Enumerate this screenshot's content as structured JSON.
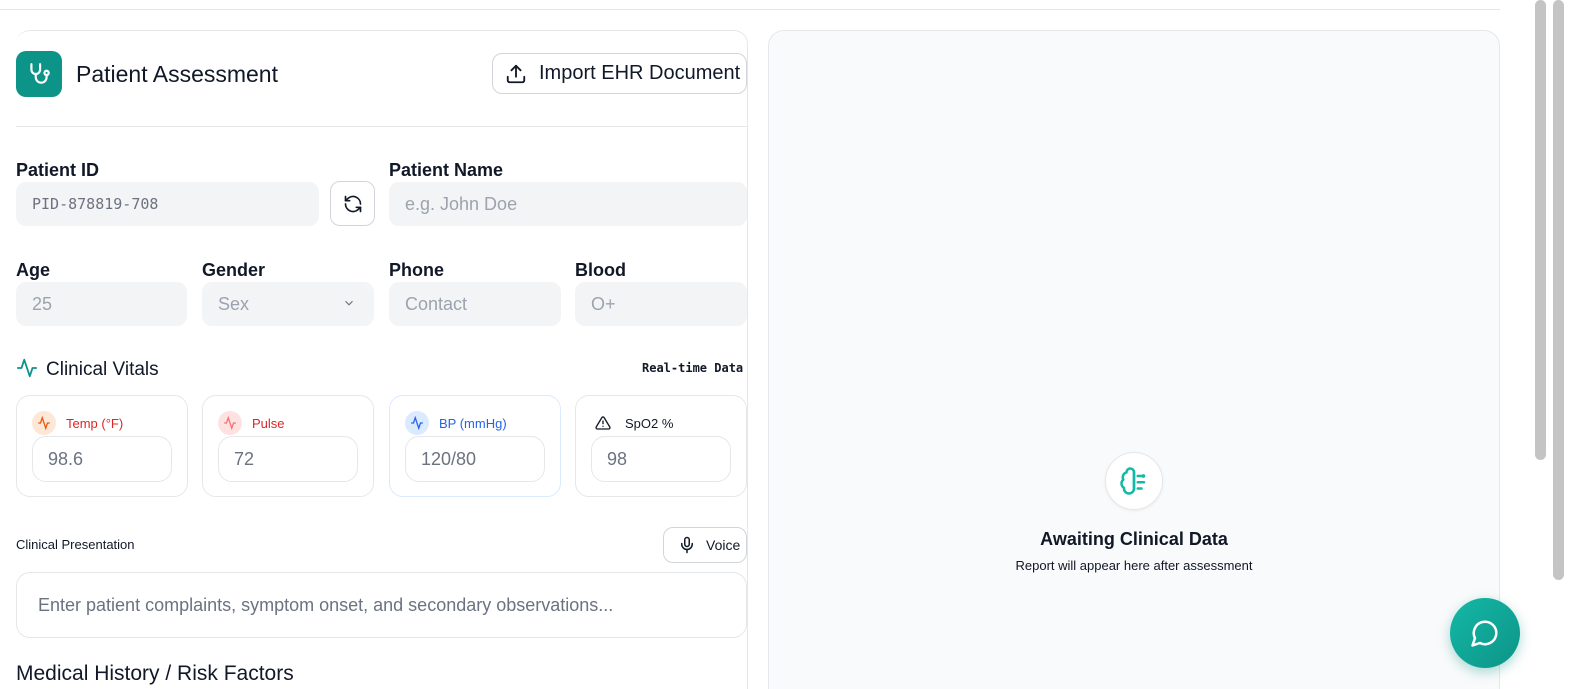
{
  "header": {
    "title": "Patient Assessment",
    "import_label": "Import EHR Document"
  },
  "form": {
    "patient_id": {
      "label": "Patient ID",
      "value": "PID-878819-708"
    },
    "patient_name": {
      "label": "Patient Name",
      "placeholder": "e.g. John Doe"
    },
    "age": {
      "label": "Age",
      "placeholder": "25"
    },
    "gender": {
      "label": "Gender",
      "selected": "Sex"
    },
    "phone": {
      "label": "Phone",
      "placeholder": "Contact"
    },
    "blood": {
      "label": "Blood",
      "placeholder": "O+"
    }
  },
  "vitals": {
    "title": "Clinical Vitals",
    "badge": "Real-time Data",
    "items": [
      {
        "label": "Temp (°F)",
        "value": "98.6",
        "color": "#dc2626",
        "chip": "#fde7d6",
        "icon": "activity-icon"
      },
      {
        "label": "Pulse",
        "value": "72",
        "color": "#dc2626",
        "chip": "#fee2e2",
        "icon": "activity-icon"
      },
      {
        "label": "BP (mmHg)",
        "value": "120/80",
        "color": "#2563eb",
        "chip": "#dbeafe",
        "icon": "activity-icon"
      },
      {
        "label": "SpO2 %",
        "value": "98",
        "color": "#111827",
        "chip": "#ffffff",
        "icon": "warning-icon"
      }
    ]
  },
  "presentation": {
    "label": "Clinical Presentation",
    "voice_label": "Voice",
    "placeholder": "Enter patient complaints, symptom onset, and secondary observations..."
  },
  "history": {
    "title": "Medical History / Risk Factors"
  },
  "report": {
    "title": "Awaiting Clinical Data",
    "subtitle": "Report will appear here after assessment"
  },
  "colors": {
    "accent": "#0d9488",
    "accent_light": "#14b8a6"
  }
}
